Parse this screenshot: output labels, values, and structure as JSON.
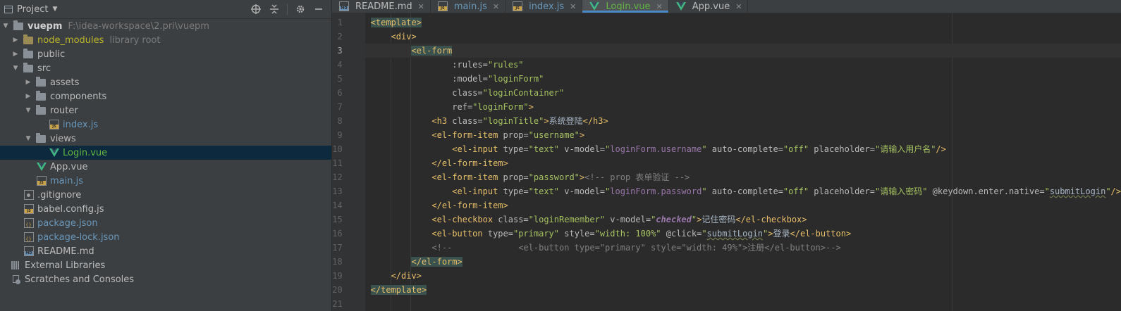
{
  "project_panel": {
    "title": "Project",
    "tools": [
      "crosshair-icon",
      "collapse-icon",
      "gear-icon",
      "minimize-icon"
    ],
    "root": {
      "name": "vuepm",
      "path": "F:\\idea-workspace\\2.pri\\vuepm"
    },
    "items": [
      {
        "name": "node_modules",
        "hint": "library root"
      },
      {
        "name": "public"
      },
      {
        "name": "src"
      },
      {
        "name": "assets"
      },
      {
        "name": "components"
      },
      {
        "name": "router"
      },
      {
        "name": "index.js"
      },
      {
        "name": "views"
      },
      {
        "name": "Login.vue"
      },
      {
        "name": "App.vue"
      },
      {
        "name": "main.js"
      },
      {
        "name": ".gitignore"
      },
      {
        "name": "babel.config.js"
      },
      {
        "name": "package.json"
      },
      {
        "name": "package-lock.json"
      },
      {
        "name": "README.md"
      },
      {
        "name": "External Libraries"
      },
      {
        "name": "Scratches and Consoles"
      }
    ]
  },
  "tabs": [
    {
      "label": "README.md",
      "icon": "markdown-file-icon"
    },
    {
      "label": "main.js",
      "icon": "js-file-icon"
    },
    {
      "label": "index.js",
      "icon": "js-file-icon"
    },
    {
      "label": "Login.vue",
      "icon": "vue-file-icon",
      "active": true
    },
    {
      "label": "App.vue",
      "icon": "vue-file-icon"
    }
  ],
  "line_numbers": [
    "1",
    "2",
    "3",
    "4",
    "5",
    "6",
    "7",
    "8",
    "9",
    "10",
    "11",
    "12",
    "13",
    "14",
    "15",
    "16",
    "17",
    "18",
    "19",
    "20",
    "21"
  ],
  "code": {
    "l1": {
      "t1": "<template>"
    },
    "l2": {
      "t1": "<div>"
    },
    "l3": {
      "t1": "<el-form"
    },
    "l4": {
      "a1": ":rules=",
      "v1": "\"rules\""
    },
    "l5": {
      "a1": ":model=",
      "v1": "\"loginForm\""
    },
    "l6": {
      "a1": "class=",
      "v1": "\"loginContainer\""
    },
    "l7": {
      "a1": "ref=",
      "v1": "\"loginForm\"",
      "t2": ">"
    },
    "l8": {
      "t1": "<h3 ",
      "a1": "class=",
      "v1": "\"loginTitle\"",
      "t2": ">",
      "txt": "系统登陆",
      "t3": "</h3>"
    },
    "l9": {
      "t1": "<el-form-item ",
      "a1": "prop=",
      "v1": "\"username\"",
      "t2": ">"
    },
    "l10": {
      "t1": "<el-input ",
      "a1": "type=",
      "v1": "\"text\"",
      "a2": " v-model=",
      "v2a": "\"",
      "vr": "loginForm.username",
      "v2b": "\"",
      "a3": " auto-complete=",
      "v3": "\"off\"",
      "a4": " placeholder=",
      "v4": "\"请输入用户名\"",
      "t2": "/>"
    },
    "l11": {
      "t1": "</el-form-item>"
    },
    "l12": {
      "t1": "<el-form-item ",
      "a1": "prop=",
      "v1": "\"password\"",
      "t2": ">",
      "cm": "<!-- prop 表单验证 -->"
    },
    "l13": {
      "t1": "<el-input ",
      "a1": "type=",
      "v1": "\"text\"",
      "a2": " v-model=",
      "v2a": "\"",
      "vr": "loginForm.password",
      "v2b": "\"",
      "a3": " auto-complete=",
      "v3": "\"off\"",
      "a4": " placeholder=",
      "v4": "\"请输入密码\"",
      "a5": " @keydown.enter.native=",
      "v5a": "\"",
      "v5": "submitLogin",
      "v5b": "\"",
      "t2": "/>"
    },
    "l14": {
      "t1": "</el-form-item>"
    },
    "l15": {
      "t1": "<el-checkbox ",
      "a1": "class=",
      "v1": "\"loginRemember\"",
      "a2": " v-model=",
      "v2a": "\"",
      "bi": "checked",
      "v2b": "\"",
      "t2": ">",
      "txt": "记住密码",
      "t3": "</el-checkbox>"
    },
    "l16": {
      "t1": "<el-button ",
      "a1": "type=",
      "v1": "\"primary\"",
      "a2": " style=",
      "v2": "\"width: 100%\"",
      "a3": " @click=",
      "v3a": "\"",
      "v3": "submitLogin",
      "v3b": "\"",
      "t2": ">",
      "txt": "登录",
      "t3": "</el-button>"
    },
    "l17": {
      "cm": "<!--             <el-button type=\"primary\" style=\"width: 49%\">注册</el-button>-->"
    },
    "l18": {
      "t1": "</el-form>"
    },
    "l19": {
      "t1": "</div>"
    },
    "l20": {
      "t1": "</template>"
    }
  },
  "colors": {
    "accent": "#4a88c7",
    "tag": "#e8bf6a",
    "value": "#a5c261",
    "comment": "#808080",
    "vue": "#41b883"
  }
}
